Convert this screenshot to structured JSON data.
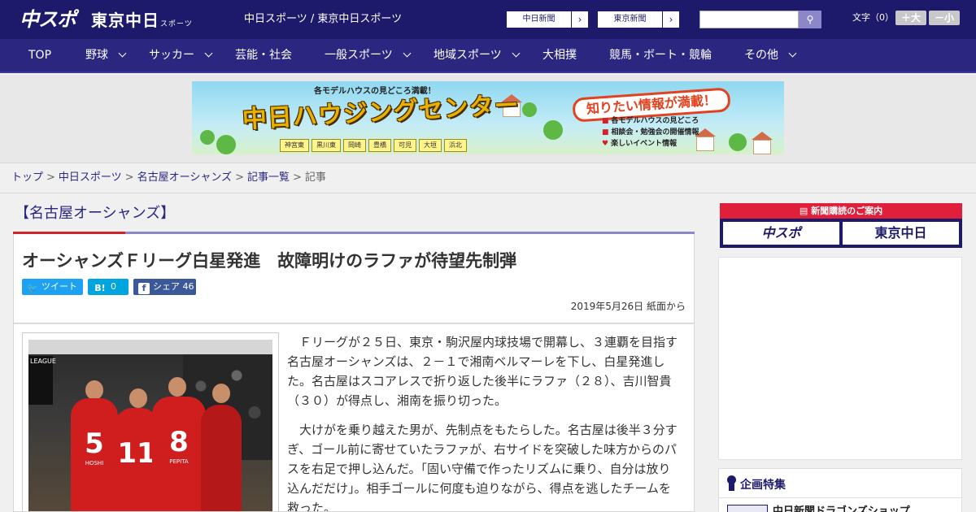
{
  "header": {
    "logo_chuspo": "中スポ",
    "logo_tokyo": "東京中日",
    "logo_tokyo_small": "スポーツ",
    "site_name": "中日スポーツ / 東京中日スポーツ",
    "paper_links": [
      {
        "label": "中日新聞",
        "arrow": "›"
      },
      {
        "label": "東京新聞",
        "arrow": "›"
      }
    ],
    "search": {
      "placeholder": "",
      "button_icon": "search-icon",
      "button_glyph": "⚲"
    },
    "font_size": {
      "label": "文字（0）",
      "increase": "＋大",
      "decrease": "－小"
    }
  },
  "nav": {
    "items": [
      {
        "label": "TOP",
        "dropdown": false
      },
      {
        "label": "野球",
        "dropdown": true
      },
      {
        "label": "サッカー",
        "dropdown": true
      },
      {
        "label": "芸能・社会",
        "dropdown": false
      },
      {
        "label": "一般スポーツ",
        "dropdown": true
      },
      {
        "label": "地域スポーツ",
        "dropdown": true
      },
      {
        "label": "大相撲",
        "dropdown": false
      },
      {
        "label": "競馬・ボート・競輪",
        "dropdown": false
      },
      {
        "label": "その他",
        "dropdown": true
      }
    ]
  },
  "ad_banner": {
    "subtitle": "各モデルハウスの見どころ満載！",
    "title": "中日ハウジングセンター",
    "slogan": "知りたい情報が満載！",
    "tags": [
      "神宮東",
      "黒川東",
      "岡崎",
      "豊橋",
      "可児",
      "大垣",
      "浜北"
    ],
    "list": [
      "各モデルハウスの見どころ",
      "相談会・勉強会の開催情報",
      "楽しいイベント情報"
    ]
  },
  "breadcrumb": {
    "items": [
      "トップ",
      "中日スポーツ",
      "名古屋オーシャンズ",
      "記事一覧"
    ],
    "current": "記事",
    "separator": ">"
  },
  "section": {
    "title": "【名古屋オーシャンズ】"
  },
  "article": {
    "title": "オーシャンズＦリーグ白星発進　故障明けのラファが待望先制弾",
    "share": {
      "tweet": {
        "icon": "twitter-icon",
        "glyph": "🐦",
        "label": "ツイート"
      },
      "hatena": {
        "icon": "hatena-bookmark-icon",
        "glyph": "B!",
        "count": "0"
      },
      "facebook": {
        "icon": "facebook-icon",
        "glyph": "f",
        "label": "シェア",
        "count": "46"
      }
    },
    "date": "2019年5月26日 紙面から",
    "photo": {
      "scoreboard": "LEAGUE",
      "players": [
        {
          "number": "5",
          "name": "HOSHI"
        },
        {
          "number": "11",
          "name": ""
        },
        {
          "number": "8",
          "name": "PEPITA"
        }
      ]
    },
    "paragraphs": [
      "Ｆリーグが２５日、東京・駒沢屋内球技場で開幕し、３連覇を目指す名古屋オーシャンズは、２－１で湘南ベルマーレを下し、白星発進した。名古屋はスコアレスで折り返した後半にラファ（２８）、吉川智貴（３０）が得点し、湘南を振り切った。",
      "大けがを乗り越えた男が、先制点をもたらした。名古屋は後半３分すぎ、ゴール前に寄せていたラファが、右サイドを突破した味方からのパスを右足で押し込んだ。「固い守備で作ったリズムに乗り、自分は放り込んだだけ」。相手ゴールに何度も迫りながら、得点を逃したチームを救った。"
    ]
  },
  "sidebar": {
    "subscribe": {
      "heading": "新聞購読のご案内",
      "logos": [
        "中スポ",
        "東京中日"
      ]
    },
    "feature": {
      "title": "企画特集",
      "item": "中日新聞ドラゴンズショップ"
    }
  },
  "colors": {
    "header_bg": "#1e1a6b",
    "nav_bg": "#2b2780",
    "accent_red": "#d2232a",
    "accent_purple": "#8b87c9",
    "twitter": "#1da1f2",
    "hatena": "#00a4de",
    "facebook": "#3b5998"
  }
}
